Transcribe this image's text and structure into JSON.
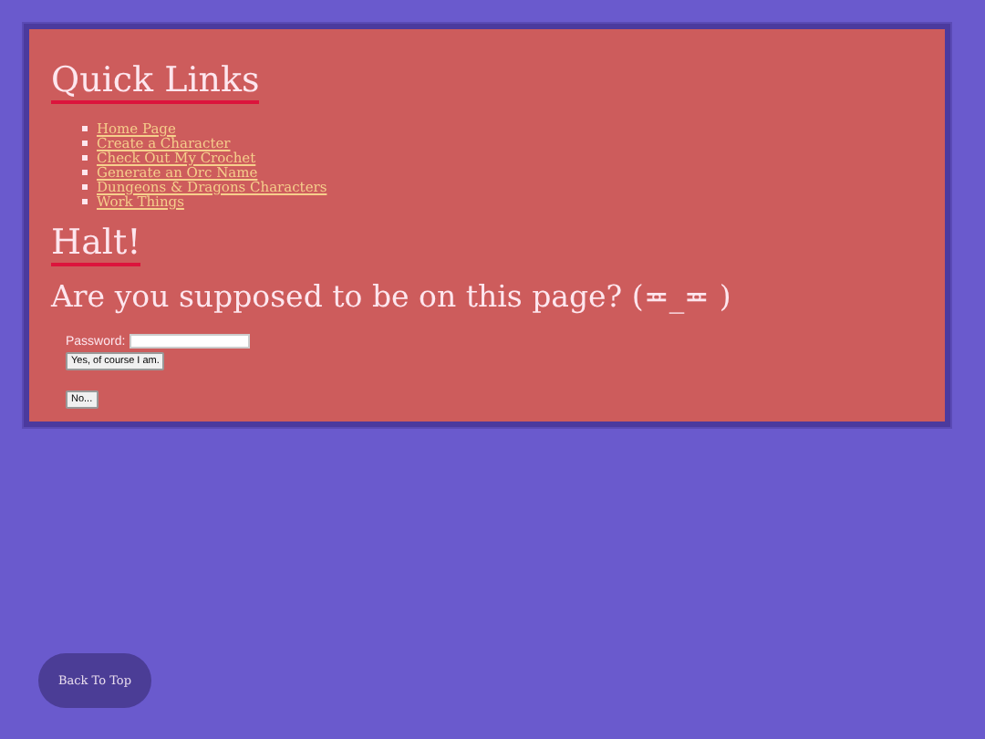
{
  "quick_links": {
    "title": "Quick Links",
    "links": [
      "Home Page",
      "Create a Character",
      "Check Out My Crochet",
      "Generate an Orc Name",
      "Dungeons & Dragons Characters",
      "Work Things"
    ]
  },
  "halt": {
    "title": "Halt!",
    "question": "Are you supposed to be on this page? (≖_≖ )",
    "password_label": "Password:",
    "confirm_button": "Yes, of course I am.",
    "deny_button": "No..."
  },
  "back_to_top": "Back To Top"
}
